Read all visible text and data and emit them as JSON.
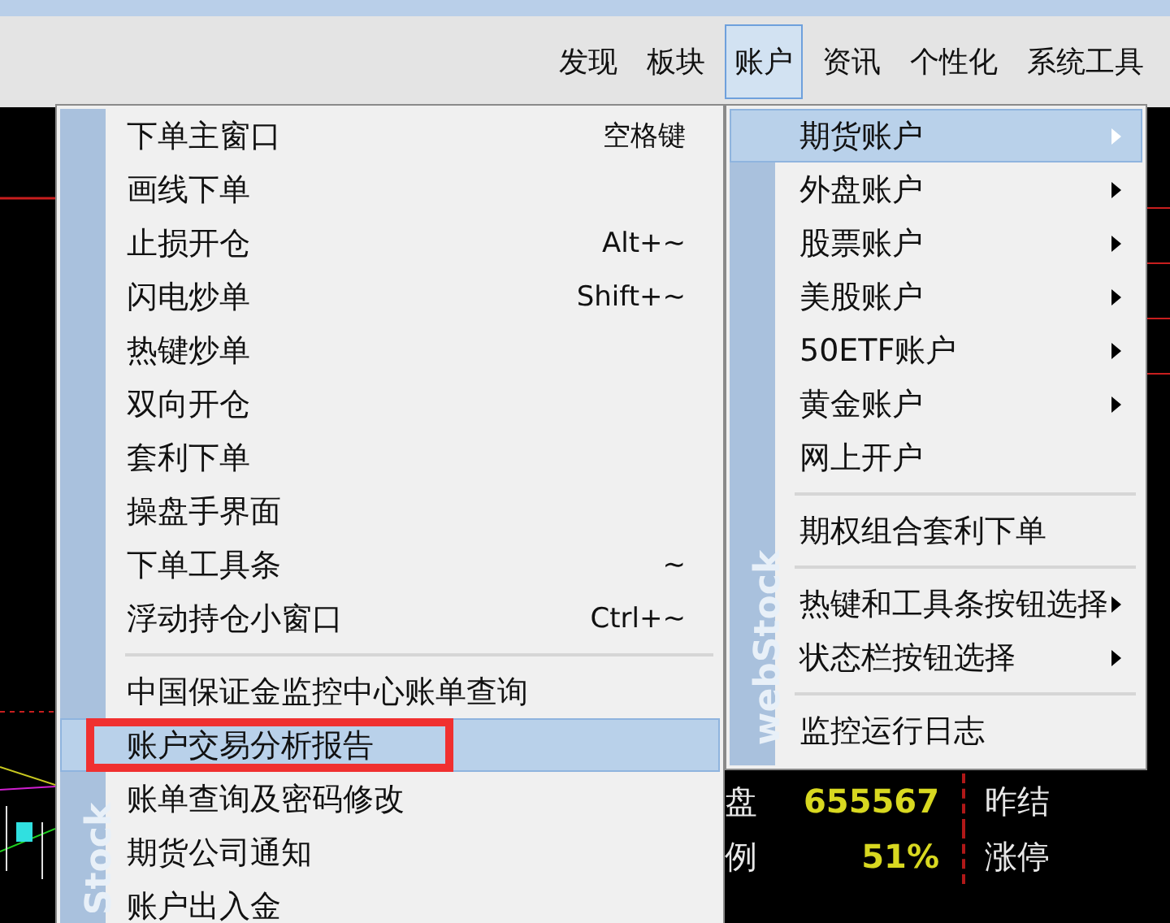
{
  "menubar": {
    "items": [
      {
        "label": "发现",
        "selected": false
      },
      {
        "label": "板块",
        "selected": false
      },
      {
        "label": "账户",
        "selected": true
      },
      {
        "label": "资讯",
        "selected": false
      },
      {
        "label": "个性化",
        "selected": false
      },
      {
        "label": "系统工具",
        "selected": false
      }
    ]
  },
  "account_menu": {
    "banner": "Stock",
    "items": [
      {
        "kind": "item",
        "label": "下单主窗口",
        "shortcut": "空格键",
        "selected": false,
        "outlined": false
      },
      {
        "kind": "item",
        "label": "画线下单",
        "selected": false,
        "outlined": false
      },
      {
        "kind": "item",
        "label": "止损开仓",
        "shortcut": "Alt+~",
        "selected": false,
        "outlined": false
      },
      {
        "kind": "item",
        "label": "闪电炒单",
        "shortcut": "Shift+~",
        "selected": false,
        "outlined": false
      },
      {
        "kind": "item",
        "label": "热键炒单",
        "selected": false,
        "outlined": false
      },
      {
        "kind": "item",
        "label": "双向开仓",
        "selected": false,
        "outlined": false
      },
      {
        "kind": "item",
        "label": "套利下单",
        "selected": false,
        "outlined": false
      },
      {
        "kind": "item",
        "label": "操盘手界面",
        "selected": false,
        "outlined": false
      },
      {
        "kind": "item",
        "label": "下单工具条",
        "shortcut": "~",
        "selected": false,
        "outlined": false
      },
      {
        "kind": "item",
        "label": "浮动持仓小窗口",
        "shortcut": "Ctrl+~",
        "selected": false,
        "outlined": false
      },
      {
        "kind": "separator"
      },
      {
        "kind": "item",
        "label": "中国保证金监控中心账单查询",
        "selected": false,
        "outlined": false
      },
      {
        "kind": "item",
        "label": "账户交易分析报告",
        "selected": true,
        "outlined": true
      },
      {
        "kind": "item",
        "label": "账单查询及密码修改",
        "selected": false,
        "outlined": false
      },
      {
        "kind": "item",
        "label": "期货公司通知",
        "selected": false,
        "outlined": false
      },
      {
        "kind": "item",
        "label": "账户出入金",
        "selected": false,
        "outlined": false
      }
    ]
  },
  "submenu": {
    "banner": "webStock",
    "items": [
      {
        "kind": "item",
        "label": "期货账户",
        "has_submenu": true,
        "selected": true
      },
      {
        "kind": "item",
        "label": "外盘账户",
        "has_submenu": true,
        "selected": false
      },
      {
        "kind": "item",
        "label": "股票账户",
        "has_submenu": true,
        "selected": false
      },
      {
        "kind": "item",
        "label": "美股账户",
        "has_submenu": true,
        "selected": false
      },
      {
        "kind": "item",
        "label": "50ETF账户",
        "has_submenu": true,
        "selected": false
      },
      {
        "kind": "item",
        "label": "黄金账户",
        "has_submenu": true,
        "selected": false
      },
      {
        "kind": "item",
        "label": "网上开户",
        "has_submenu": false,
        "selected": false
      },
      {
        "kind": "separator"
      },
      {
        "kind": "item",
        "label": "期权组合套利下单",
        "has_submenu": false,
        "selected": false
      },
      {
        "kind": "separator"
      },
      {
        "kind": "item",
        "label": "热键和工具条按钮选择",
        "has_submenu": true,
        "selected": false
      },
      {
        "kind": "item",
        "label": "状态栏按钮选择",
        "has_submenu": true,
        "selected": false
      },
      {
        "kind": "separator"
      },
      {
        "kind": "item",
        "label": "监控运行日志",
        "has_submenu": false,
        "selected": false
      }
    ]
  },
  "quote_table": {
    "rows": [
      {
        "label": "盘",
        "value": "655567",
        "label_2": "昨结"
      },
      {
        "label": "例",
        "value": "51%",
        "label_2": "涨停"
      }
    ]
  }
}
